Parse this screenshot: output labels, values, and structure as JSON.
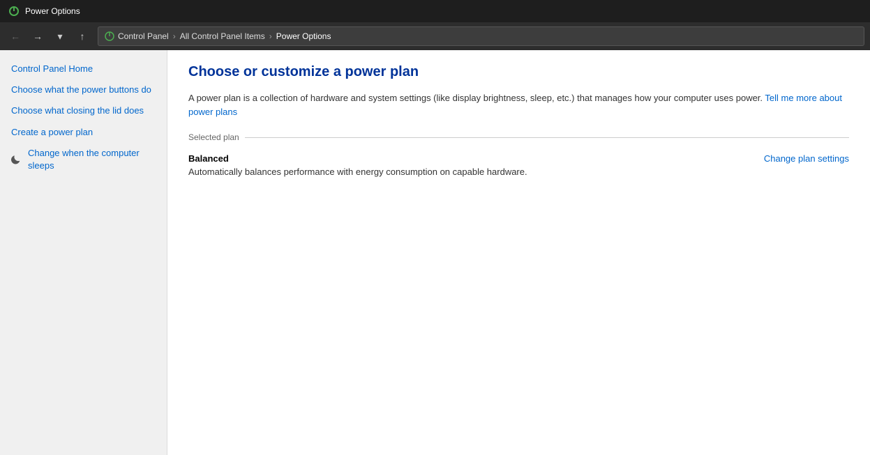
{
  "titleBar": {
    "title": "Power Options",
    "icon": "power-icon"
  },
  "navBar": {
    "backButton": "←",
    "forwardButton": "→",
    "dropdownButton": "▾",
    "upButton": "↑",
    "breadcrumbs": [
      {
        "label": "Control Panel",
        "separator": ">"
      },
      {
        "label": "All Control Panel Items",
        "separator": ">"
      },
      {
        "label": "Power Options",
        "separator": ""
      }
    ]
  },
  "sidebar": {
    "items": [
      {
        "id": "control-panel-home",
        "label": "Control Panel Home",
        "hasIcon": false
      },
      {
        "id": "power-buttons",
        "label": "Choose what the power buttons do",
        "hasIcon": false
      },
      {
        "id": "closing-lid",
        "label": "Choose what closing the lid does",
        "hasIcon": false
      },
      {
        "id": "create-power-plan",
        "label": "Create a power plan",
        "hasIcon": false
      },
      {
        "id": "computer-sleeps",
        "label": "Change when the computer sleeps",
        "hasIcon": true
      }
    ]
  },
  "content": {
    "pageTitle": "Choose or customize a power plan",
    "description": "A power plan is a collection of hardware and system settings (like display brightness, sleep, etc.) that manages how your computer uses power.",
    "learnMoreLink": "Tell me more about power plans",
    "selectedPlanLabel": "Selected plan",
    "plan": {
      "name": "Balanced",
      "description": "Automatically balances performance with energy consumption on capable hardware.",
      "changeSettingsLink": "Change plan settings"
    }
  }
}
